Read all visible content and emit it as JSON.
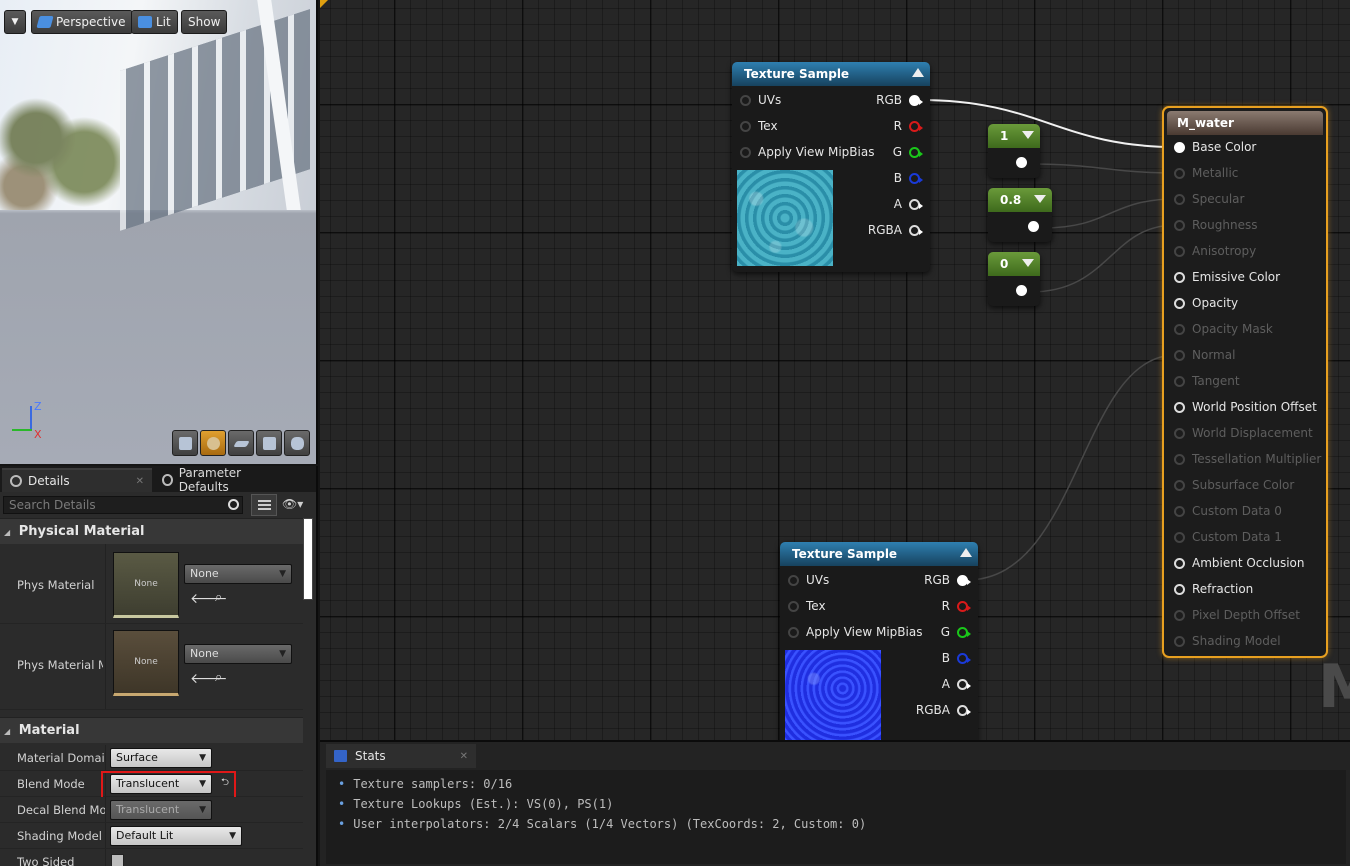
{
  "viewport": {
    "menu_icon": "chevron-down-icon",
    "buttons": {
      "perspective": "Perspective",
      "lit": "Lit",
      "show": "Show"
    },
    "axis": {
      "z": "Z",
      "x": "X"
    }
  },
  "details": {
    "tabs": [
      {
        "label": "Details",
        "icon": "magnifier-icon"
      },
      {
        "label": "Parameter Defaults",
        "icon": "magnifier-icon"
      }
    ],
    "search_placeholder": "Search Details",
    "categories": {
      "physical_material": "Physical Material",
      "material": "Material"
    },
    "phys_material": {
      "label": "Phys Material",
      "thumb": "None",
      "value": "None"
    },
    "phys_material_mask": {
      "label": "Phys Material Ma",
      "thumb": "None",
      "value": "None"
    },
    "properties": [
      {
        "label": "Material Domain",
        "value": "Surface"
      },
      {
        "label": "Blend Mode",
        "value": "Translucent"
      },
      {
        "label": "Decal Blend Mode",
        "value": "Translucent"
      },
      {
        "label": "Shading Model",
        "value": "Default Lit"
      },
      {
        "label": "Two Sided"
      }
    ]
  },
  "graph": {
    "texture_nodes": [
      {
        "title": "Texture Sample",
        "inputs": [
          "UVs",
          "Tex",
          "Apply View MipBias"
        ],
        "outputs": [
          "RGB",
          "R",
          "G",
          "B",
          "A",
          "RGBA"
        ],
        "preview": "water"
      },
      {
        "title": "Texture Sample",
        "inputs": [
          "UVs",
          "Tex",
          "Apply View MipBias"
        ],
        "outputs": [
          "RGB",
          "R",
          "G",
          "B",
          "A",
          "RGBA"
        ],
        "preview": "normal"
      }
    ],
    "constants": [
      "1",
      "0.8",
      "0"
    ],
    "result": {
      "title": "M_water",
      "pins": [
        {
          "label": "Base Color",
          "state": "connected"
        },
        {
          "label": "Metallic",
          "state": "disabled"
        },
        {
          "label": "Specular",
          "state": "disabled"
        },
        {
          "label": "Roughness",
          "state": "disabled"
        },
        {
          "label": "Anisotropy",
          "state": "disabled"
        },
        {
          "label": "Emissive Color",
          "state": "enabled"
        },
        {
          "label": "Opacity",
          "state": "enabled"
        },
        {
          "label": "Opacity Mask",
          "state": "disabled"
        },
        {
          "label": "Normal",
          "state": "disabled"
        },
        {
          "label": "Tangent",
          "state": "disabled"
        },
        {
          "label": "World Position Offset",
          "state": "enabled"
        },
        {
          "label": "World Displacement",
          "state": "disabled"
        },
        {
          "label": "Tessellation Multiplier",
          "state": "disabled"
        },
        {
          "label": "Subsurface Color",
          "state": "disabled"
        },
        {
          "label": "Custom Data 0",
          "state": "disabled"
        },
        {
          "label": "Custom Data 1",
          "state": "disabled"
        },
        {
          "label": "Ambient Occlusion",
          "state": "enabled"
        },
        {
          "label": "Refraction",
          "state": "enabled"
        },
        {
          "label": "Pixel Depth Offset",
          "state": "disabled"
        },
        {
          "label": "Shading Model",
          "state": "disabled"
        }
      ]
    },
    "watermark": "M"
  },
  "stats": {
    "tab_label": "Stats",
    "lines": [
      "Texture samplers: 0/16",
      "Texture Lookups (Est.): VS(0), PS(1)",
      "User interpolators: 2/4 Scalars (1/4 Vectors) (TexCoords: 2, Custom: 0)"
    ]
  },
  "colors": {
    "accent": "#e8a020",
    "node_header": "#2f7fb0",
    "constant_header": "#6a9a3a",
    "highlight_box": "#e01818"
  }
}
